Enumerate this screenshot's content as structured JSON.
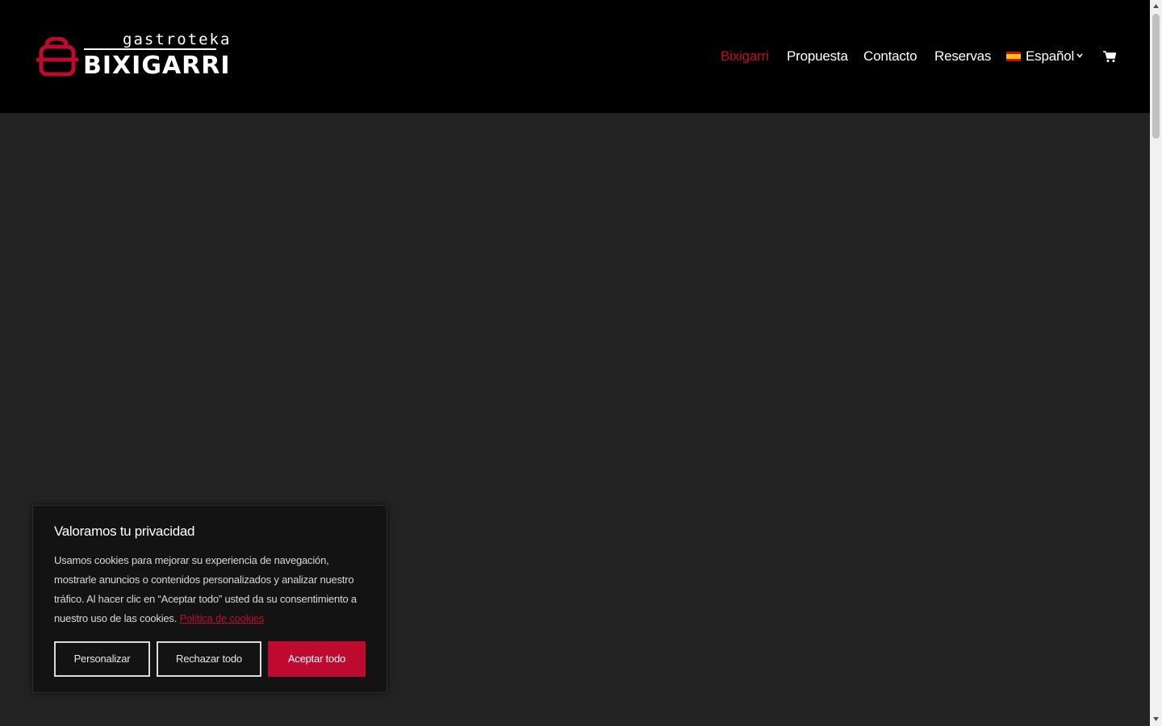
{
  "brand": {
    "tagline": "gastroteka",
    "name": "BIXIGARRI",
    "accent_color": "#bf0a30"
  },
  "nav": {
    "items": [
      {
        "label": "Bixigarri",
        "active": true
      },
      {
        "label": "Propuesta",
        "active": false
      },
      {
        "label": "Contacto",
        "active": false
      },
      {
        "label": "Reservas",
        "active": false
      }
    ],
    "language": "Español",
    "language_flag_icon": "spain-flag-icon",
    "dropdown_icon": "chevron-down-icon",
    "cart_icon": "shopping-cart-icon"
  },
  "cookie": {
    "title": "Valoramos tu privacidad",
    "text": "Usamos cookies para mejorar su experiencia de navegación, mostrarle anuncios o contenidos personalizados y analizar nuestro tráfico. Al hacer clic en “Aceptar todo” usted da su consentimiento a nuestro uso de las cookies.",
    "policy_link": "Política de cookies",
    "buttons": {
      "customize": "Personalizar",
      "reject": "Rechazar todo",
      "accept": "Aceptar todo"
    }
  }
}
